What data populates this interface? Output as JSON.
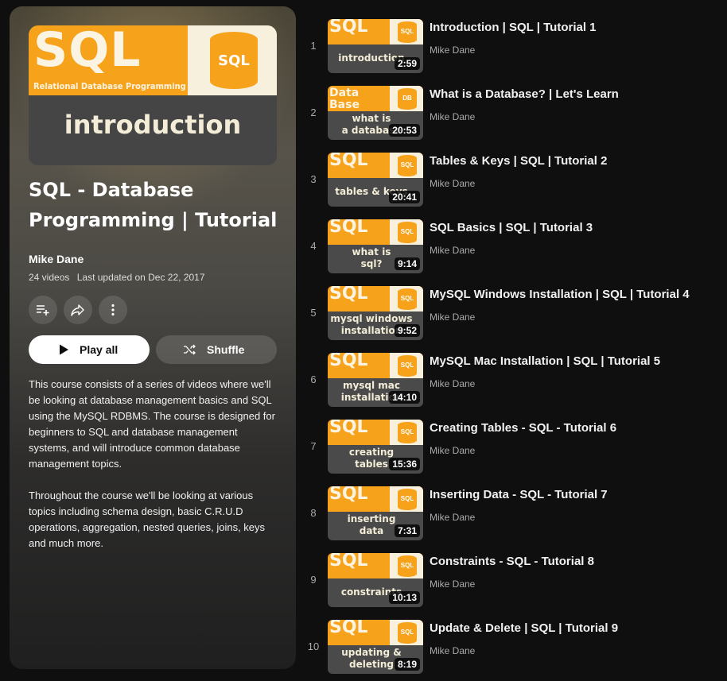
{
  "playlist": {
    "hero": {
      "logo_text": "SQL",
      "logo_subtitle": "Relational Database Programming",
      "can_text": "SQL",
      "episode_title": "introduction"
    },
    "title": "SQL - Database Programming | Tutorial",
    "author": "Mike Dane",
    "video_count": "24 videos",
    "last_updated": "Last updated on Dec 22, 2017",
    "actions": {
      "save_icon": "playlist-add-icon",
      "share_icon": "share-icon",
      "more_icon": "more-vert-icon"
    },
    "play_all_label": "Play all",
    "shuffle_label": "Shuffle",
    "description_1": "This course consists of a series of videos where we'll be looking at database management basics and SQL using the MySQL RDBMS. The course is designed for beginners to SQL and database management systems, and will introduce common database management topics.",
    "description_2": "Throughout the course we'll be looking at various topics including schema design, basic C.R.U.D operations, aggregation, nested queries, joins, keys and much more."
  },
  "colors": {
    "accent_orange": "#f7a21b",
    "cream": "#f6f0dc",
    "background": "#0f0f0f"
  },
  "videos": [
    {
      "index": "1",
      "title": "Introduction | SQL | Tutorial 1",
      "channel": "Mike Dane",
      "duration": "2:59",
      "thumb_logo": "SQL",
      "thumb_can": "SQL",
      "thumb_line1": "",
      "thumb_line2": "introduction"
    },
    {
      "index": "2",
      "title": "What is a Database? | Let's Learn",
      "channel": "Mike Dane",
      "duration": "20:53",
      "thumb_logo": "Data Base",
      "thumb_can": "DB",
      "thumb_line1": "what is",
      "thumb_line2": "a database"
    },
    {
      "index": "3",
      "title": "Tables & Keys | SQL | Tutorial 2",
      "channel": "Mike Dane",
      "duration": "20:41",
      "thumb_logo": "SQL",
      "thumb_can": "SQL",
      "thumb_line1": "",
      "thumb_line2": "tables & keys"
    },
    {
      "index": "4",
      "title": "SQL Basics | SQL | Tutorial 3",
      "channel": "Mike Dane",
      "duration": "9:14",
      "thumb_logo": "SQL",
      "thumb_can": "SQL",
      "thumb_line1": "what is",
      "thumb_line2": "sql?"
    },
    {
      "index": "5",
      "title": "MySQL Windows Installation | SQL | Tutorial 4",
      "channel": "Mike Dane",
      "duration": "9:52",
      "thumb_logo": "SQL",
      "thumb_can": "SQL",
      "thumb_line1": "mysql windows",
      "thumb_line2": "installation"
    },
    {
      "index": "6",
      "title": "MySQL Mac Installation | SQL | Tutorial 5",
      "channel": "Mike Dane",
      "duration": "14:10",
      "thumb_logo": "SQL",
      "thumb_can": "SQL",
      "thumb_line1": "mysql mac",
      "thumb_line2": "installation"
    },
    {
      "index": "7",
      "title": "Creating Tables - SQL - Tutorial 6",
      "channel": "Mike Dane",
      "duration": "15:36",
      "thumb_logo": "SQL",
      "thumb_can": "SQL",
      "thumb_line1": "creating",
      "thumb_line2": "tables"
    },
    {
      "index": "8",
      "title": "Inserting Data - SQL - Tutorial 7",
      "channel": "Mike Dane",
      "duration": "7:31",
      "thumb_logo": "SQL",
      "thumb_can": "SQL",
      "thumb_line1": "inserting",
      "thumb_line2": "data"
    },
    {
      "index": "9",
      "title": "Constraints - SQL - Tutorial 8",
      "channel": "Mike Dane",
      "duration": "10:13",
      "thumb_logo": "SQL",
      "thumb_can": "SQL",
      "thumb_line1": "",
      "thumb_line2": "constraints"
    },
    {
      "index": "10",
      "title": "Update & Delete | SQL | Tutorial 9",
      "channel": "Mike Dane",
      "duration": "8:19",
      "thumb_logo": "SQL",
      "thumb_can": "SQL",
      "thumb_line1": "updating &",
      "thumb_line2": "deleting"
    }
  ]
}
